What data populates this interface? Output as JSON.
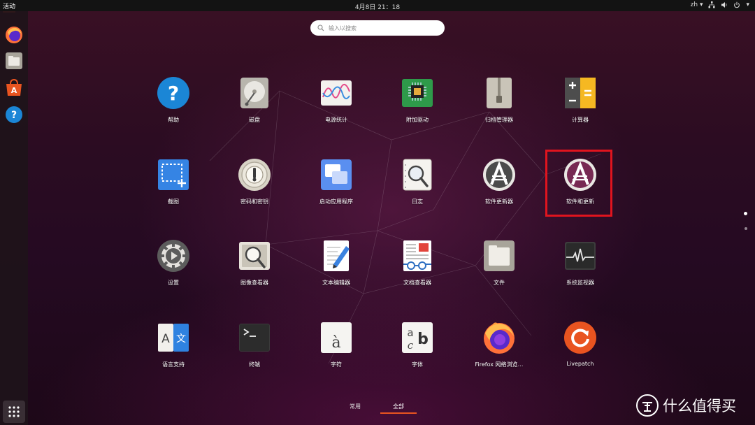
{
  "topbar": {
    "activities": "活动",
    "clock": "4月8日  21：18",
    "language": "zh ▾"
  },
  "dock": {
    "items": [
      "firefox-icon",
      "files-icon",
      "software-icon",
      "help-icon",
      "show-apps-icon"
    ]
  },
  "search": {
    "placeholder": "输入以搜索"
  },
  "apps": [
    {
      "label": "帮助",
      "icon": "help"
    },
    {
      "label": "磁盘",
      "icon": "disks"
    },
    {
      "label": "电源统计",
      "icon": "power-statistics"
    },
    {
      "label": "附加驱动",
      "icon": "additional-drivers"
    },
    {
      "label": "归档管理器",
      "icon": "archive-manager"
    },
    {
      "label": "计算器",
      "icon": "calculator"
    },
    {
      "label": "截图",
      "icon": "screenshot"
    },
    {
      "label": "密码和密钥",
      "icon": "passwords-keys"
    },
    {
      "label": "启动应用程序",
      "icon": "startup-apps"
    },
    {
      "label": "日志",
      "icon": "logs"
    },
    {
      "label": "软件更新器",
      "icon": "software-updater"
    },
    {
      "label": "软件和更新",
      "icon": "software-updates"
    },
    {
      "label": "设置",
      "icon": "settings"
    },
    {
      "label": "图像查看器",
      "icon": "image-viewer"
    },
    {
      "label": "文本编辑器",
      "icon": "text-editor"
    },
    {
      "label": "文档查看器",
      "icon": "document-viewer"
    },
    {
      "label": "文件",
      "icon": "files"
    },
    {
      "label": "系统监视器",
      "icon": "system-monitor"
    },
    {
      "label": "语言支持",
      "icon": "language-support"
    },
    {
      "label": "终端",
      "icon": "terminal"
    },
    {
      "label": "字符",
      "icon": "characters"
    },
    {
      "label": "字体",
      "icon": "fonts"
    },
    {
      "label": "Firefox 网络浏览…",
      "icon": "firefox"
    },
    {
      "label": "Livepatch",
      "icon": "livepatch"
    }
  ],
  "switcher": {
    "frequent": "常用",
    "all": "全部"
  },
  "watermark": {
    "text": "什么值得买"
  }
}
